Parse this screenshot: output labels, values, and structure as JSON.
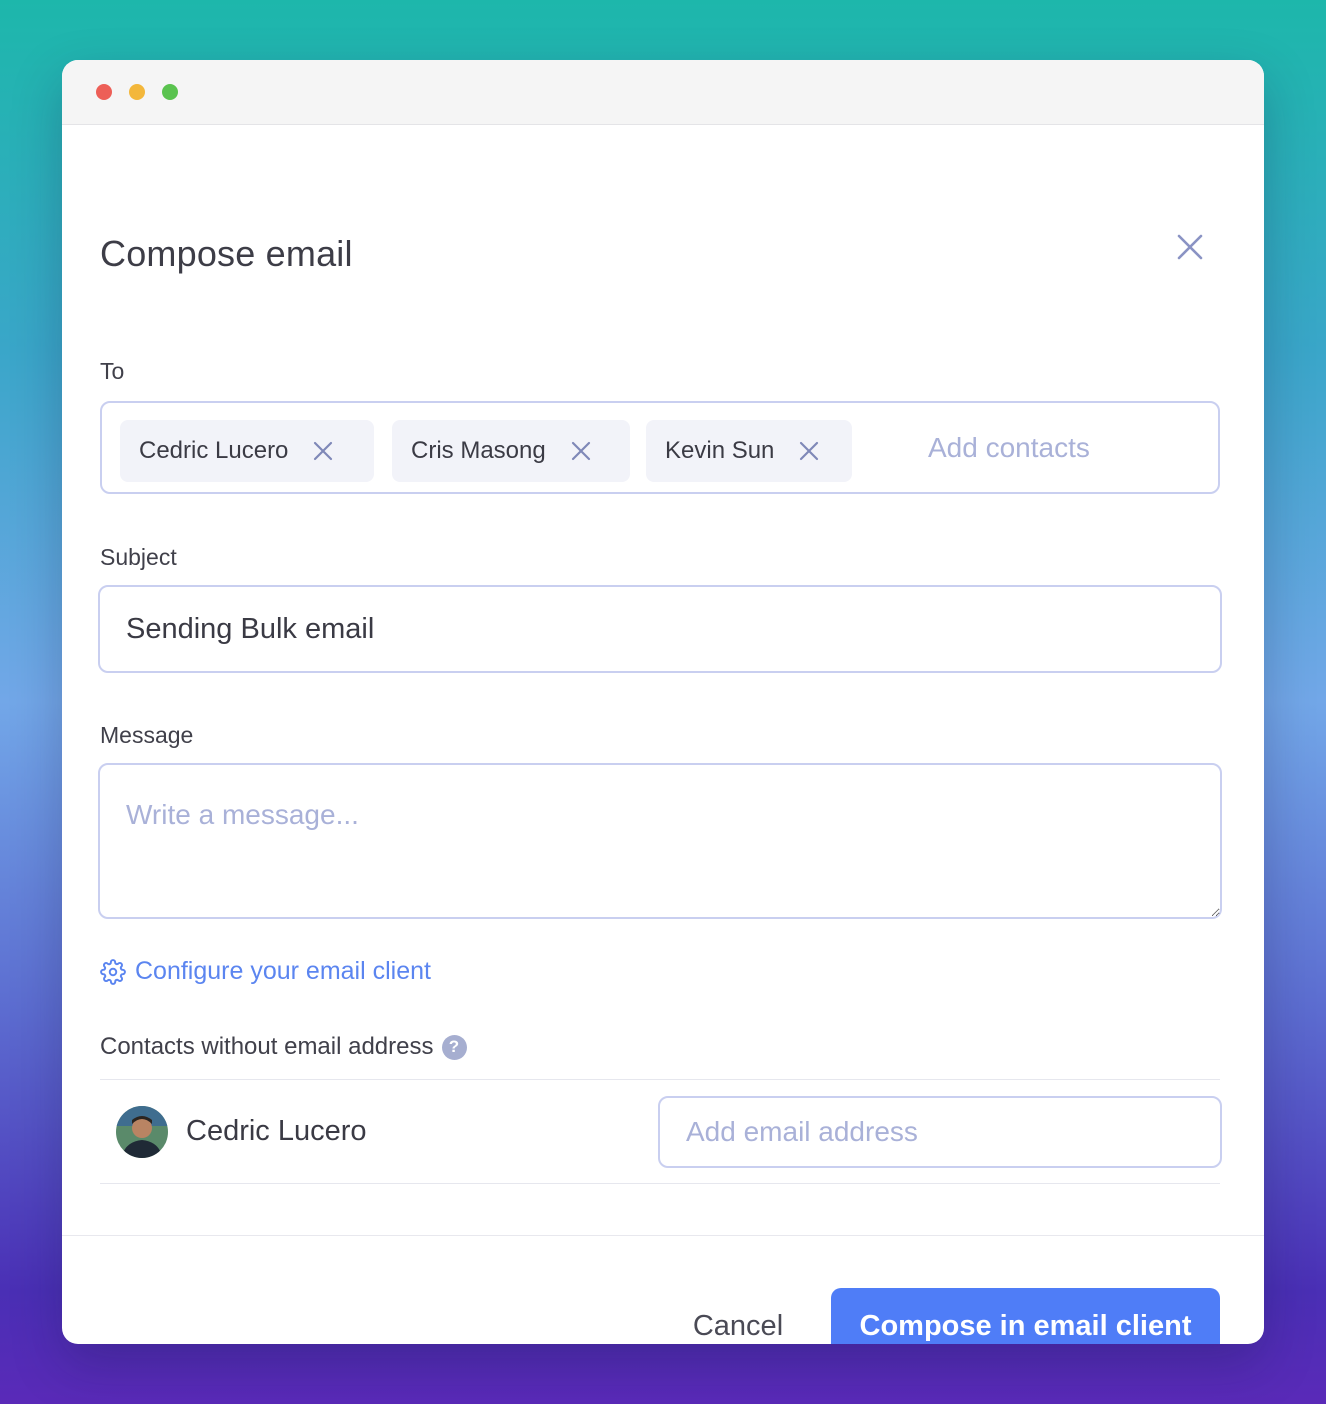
{
  "window_controls": {
    "close_color": "#ed5f57",
    "minimize_color": "#f3b73b",
    "zoom_color": "#5ac34f"
  },
  "dialog": {
    "title": "Compose email",
    "close_icon": "close-icon"
  },
  "to": {
    "label": "To",
    "recipients": [
      {
        "name": "Cedric Lucero"
      },
      {
        "name": "Cris Masong"
      },
      {
        "name": "Kevin Sun"
      }
    ],
    "placeholder": "Add contacts"
  },
  "subject": {
    "label": "Subject",
    "value": "Sending Bulk email"
  },
  "message": {
    "label": "Message",
    "placeholder": "Write a message...",
    "value": ""
  },
  "configure": {
    "icon": "gear-icon",
    "label": "Configure your email client"
  },
  "contacts_without_email": {
    "label": "Contacts without email address",
    "help_icon": "help-icon",
    "contacts": [
      {
        "name": "Cedric Lucero",
        "email_placeholder": "Add email address"
      }
    ]
  },
  "footer": {
    "cancel_label": "Cancel",
    "compose_label": "Compose in email client"
  },
  "colors": {
    "accent": "#4f7df7",
    "link": "#5b85f0"
  }
}
